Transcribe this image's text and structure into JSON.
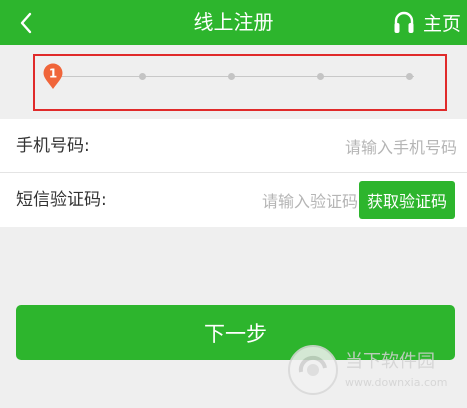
{
  "header": {
    "title": "线上注册",
    "home_label": "主页",
    "back_icon": "chevron-left-icon",
    "support_icon": "headset-icon",
    "color": "#2db52d"
  },
  "steps": {
    "current_step": "1",
    "total_steps": 5,
    "marker_color": "#f0653a",
    "highlight_color": "#e02a2a"
  },
  "form": {
    "phone": {
      "label": "手机号码:",
      "placeholder": "请输入手机号码",
      "value": ""
    },
    "code": {
      "label": "短信验证码:",
      "placeholder": "请输入验证码",
      "value": ""
    },
    "sms_button_label": "获取验证码"
  },
  "next_button_label": "下一步"
}
